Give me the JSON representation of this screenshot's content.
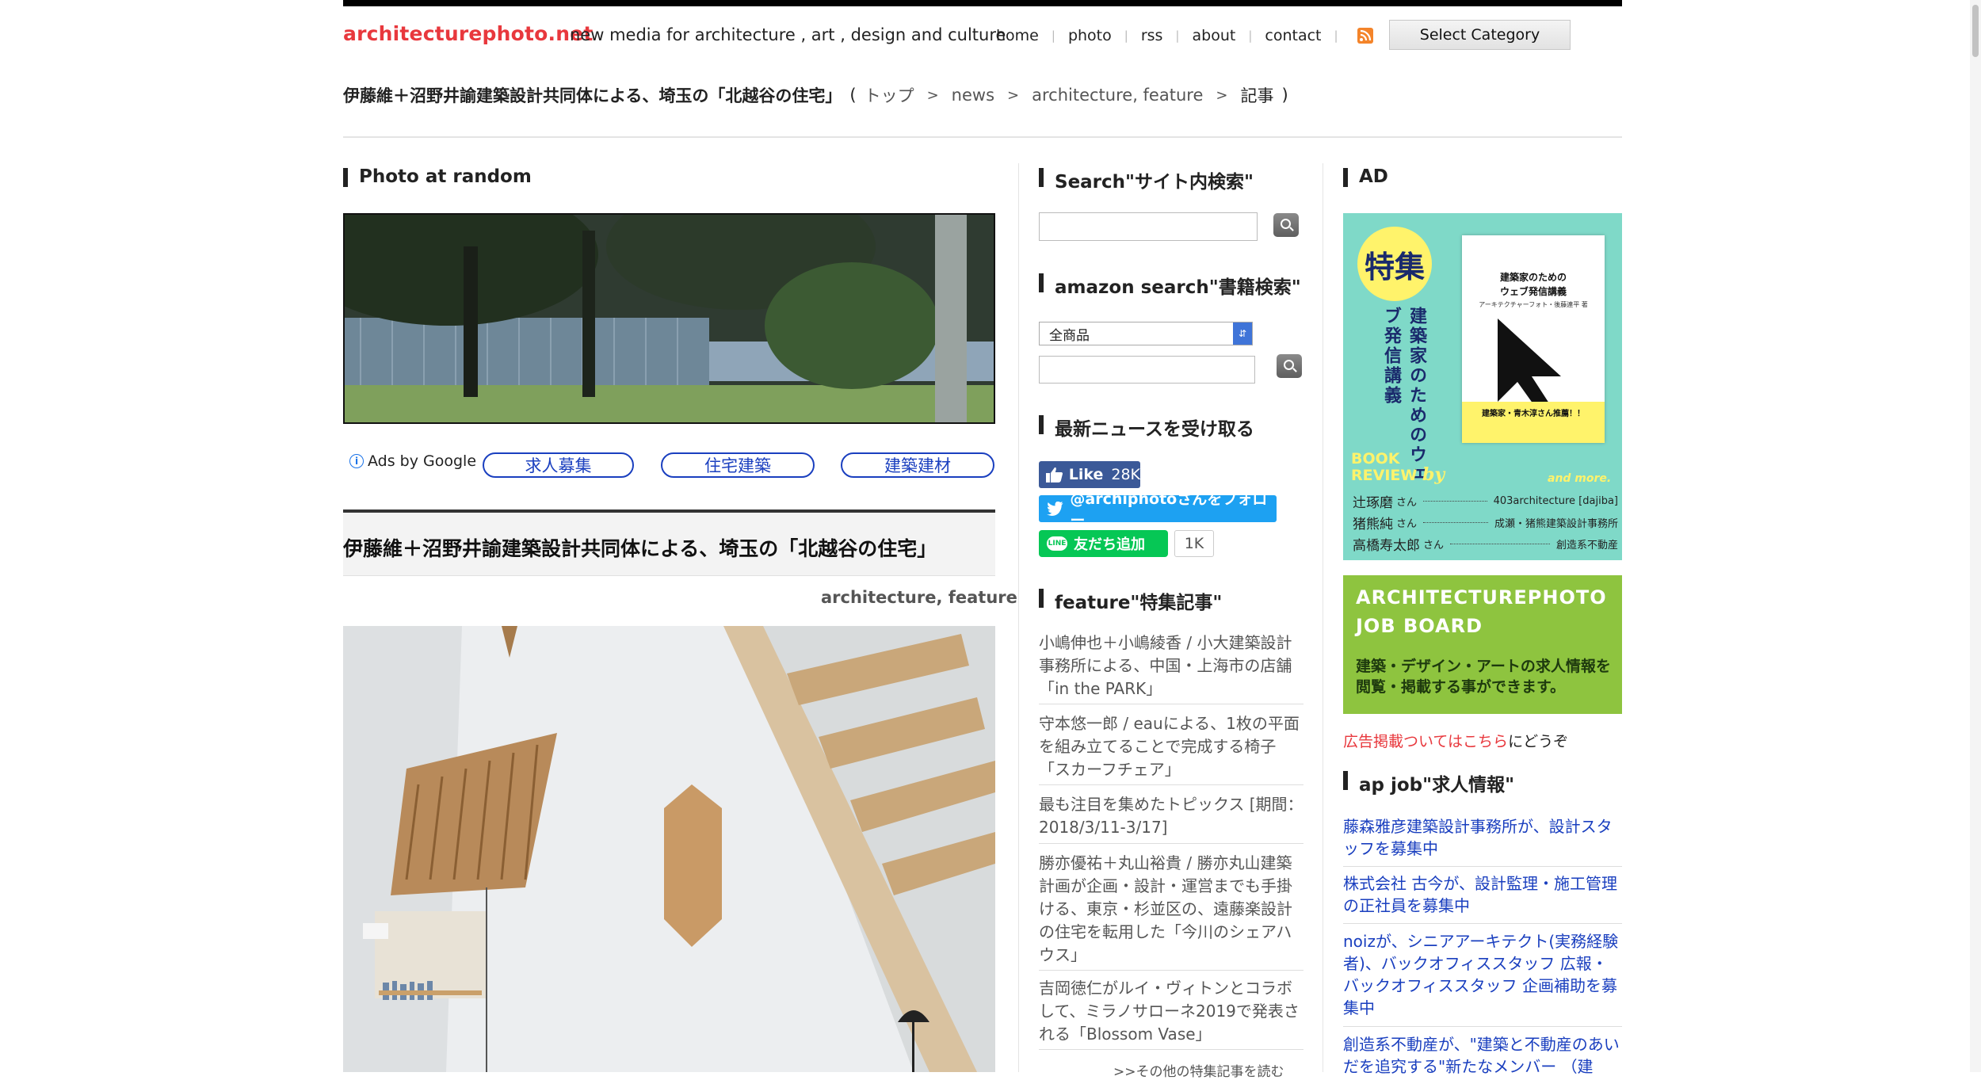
{
  "header": {
    "logo": "architecturephoto.net",
    "tagline": "new media for architecture , art , design and culture",
    "nav": [
      "home",
      "photo",
      "rss",
      "about",
      "contact"
    ],
    "select_category": "Select Category"
  },
  "breadcrumb": {
    "title": "伊藤維＋沼野井諭建築設計共同体による、埼玉の「北越谷の住宅」",
    "open": "(",
    "items": [
      "トップ",
      "news",
      "architecture, feature",
      "記事"
    ],
    "close": ")"
  },
  "left": {
    "section_title": "Photo at random",
    "ads_by_google": "Ads by Google",
    "ad_links": [
      "求人募集",
      "住宅建築",
      "建築建材"
    ],
    "article_title": "伊藤維＋沼野井諭建築設計共同体による、埼玉の「北越谷の住宅」",
    "article_category": "architecture, feature"
  },
  "middle": {
    "search_title": "Search\"サイト内検索\"",
    "amazon_title": "amazon search\"書籍検索\"",
    "amazon_select": "全商品",
    "news_title": "最新ニュースを受け取る",
    "fb_like": "Like",
    "fb_count": "28K",
    "twitter_follow": "@archiphotoさんをフォロー",
    "line_add": "友だち追加",
    "line_count": "1K",
    "feature_title": "feature\"特集記事\"",
    "features": [
      "小嶋伸也＋小嶋綾香 / 小大建築設計事務所による、中国・上海市の店舗「in the PARK」",
      "守本悠一郎 / eauによる、1枚の平面を組み立てることで完成する椅子「スカーフチェア」",
      "最も注目を集めたトピックス [期間：2018/3/11-3/17]",
      "勝亦優祐＋丸山裕貴 / 勝亦丸山建築計画が企画・設計・運営までも手掛ける、東京・杉並区の、遠藤楽設計の住宅を転用した「今川のシェアハウス」",
      "吉岡徳仁がルイ・ヴィトンとコラボして、ミラノサローネ2019で発表される「Blossom Vase」"
    ],
    "more_features": ">>その他の特集記事を読む"
  },
  "right": {
    "ad_title": "AD",
    "book": {
      "badge": "特集",
      "vertical_title": "建築家のためのウェブ発信講義",
      "cover_title_1": "建築家のための",
      "cover_title_2": "ウェブ発信講義",
      "cover_author": "アーキテクチャーフォト・後藤連平 著",
      "cover_recommend": "建築家・青木淳さん推薦！！",
      "review_1": "BOOK",
      "review_2": "REVIEW",
      "review_by": "by",
      "and_more": "and more.",
      "reviewers": [
        {
          "name": "辻琢磨",
          "san": "さん",
          "org": "403architecture [dajiba]"
        },
        {
          "name": "猪熊純",
          "san": "さん",
          "org": "成瀬・猪熊建築設計事務所"
        },
        {
          "name": "高橋寿太郎",
          "san": "さん",
          "org": "創造系不動産"
        }
      ]
    },
    "job_board_title_1": "ARCHITECTUREPHOTO",
    "job_board_title_2": "JOB BOARD",
    "job_board_text_1": "建築・デザイン・アートの求人情報を",
    "job_board_text_2": "閲覧・掲載する事ができます。",
    "ad_notice_link": "広告掲載ついてはこちら",
    "ad_notice_suffix": "にどうぞ",
    "apjob_title": "ap job\"求人情報\"",
    "jobs": [
      "藤森雅彦建築設計事務所が、設計スタッフを募集中",
      "株式会社 古今が、設計監理・施工管理の正社員を募集中",
      "noizが、シニアアーキテクト(実務経験者)、バックオフィススタッフ 広報・バックオフィススタッフ 企画補助を募集中",
      "創造系不動産が、\"建築と不動産のあいだを追究する\"新たなメンバー （建"
    ]
  },
  "colors": {
    "logo_red": "#e8383d",
    "link_blue": "#1a3fbf",
    "facebook": "#3b5998",
    "twitter": "#1da1f2",
    "line": "#06c755",
    "book_bg": "#7fd9c8",
    "job_board_bg": "#8ec43f"
  }
}
